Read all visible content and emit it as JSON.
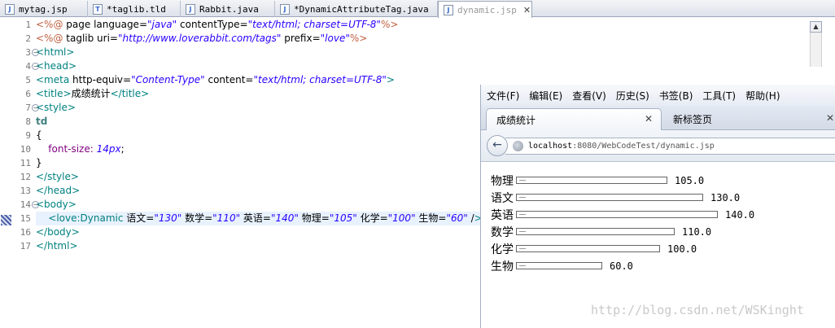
{
  "editor_tabs": [
    {
      "name": "mytag.jsp",
      "active": false
    },
    {
      "name": "*taglib.tld",
      "active": false
    },
    {
      "name": "Rabbit.java",
      "active": false
    },
    {
      "name": "*DynamicAttributeTag.java",
      "active": false
    },
    {
      "name": "dynamic.jsp",
      "active": true
    }
  ],
  "editor": {
    "line_numbers": [
      "1",
      "2",
      "3",
      "4",
      "5",
      "6",
      "7",
      "8",
      "9",
      "10",
      "11",
      "12",
      "13",
      "14",
      "15",
      "16",
      "17"
    ],
    "lines": [
      "<%@ page language=\"java\" contentType=\"text/html; charset=UTF-8\"%>",
      "<%@ taglib uri=\"http://www.loverabbit.com/tags\" prefix=\"love\"%>",
      "<html>",
      "<head>",
      "<meta http-equiv=\"Content-Type\" content=\"text/html; charset=UTF-8\">",
      "<title>成绩统计</title>",
      "<style>",
      "td",
      "{",
      "    font-size: 14px;",
      "}",
      "</style>",
      "</head>",
      "<body>",
      "    <love:Dynamic 语文=\"130\" 数学=\"110\" 英语=\"140\" 物理=\"105\" 化学=\"100\" 生物=\"60\" />",
      "</body>",
      "</html>"
    ]
  },
  "browser": {
    "menu": [
      "文件(F)",
      "编辑(E)",
      "查看(V)",
      "历史(S)",
      "书签(B)",
      "工具(T)",
      "帮助(H)"
    ],
    "tabs": [
      "成绩统计",
      "新标签页"
    ],
    "close_glyph": "✕",
    "back_glyph": "←",
    "url_host": "localhost",
    "url_rest": ":8080/WebCodeTest/dynamic.jsp",
    "scores": [
      {
        "subject": "物理",
        "value": 105.0,
        "display": "105.0"
      },
      {
        "subject": "语文",
        "value": 130.0,
        "display": "130.0"
      },
      {
        "subject": "英语",
        "value": 140.0,
        "display": "140.0"
      },
      {
        "subject": "数学",
        "value": 110.0,
        "display": "110.0"
      },
      {
        "subject": "化学",
        "value": 100.0,
        "display": "100.0"
      },
      {
        "subject": "生物",
        "value": 60.0,
        "display": "60.0"
      }
    ]
  },
  "watermark": "http://blog.csdn.net/WSKinght",
  "colors": {
    "tag": "#008080",
    "string": "#2a00ff",
    "attribute": "#7f007f",
    "jsp": "#bf5f3f"
  }
}
